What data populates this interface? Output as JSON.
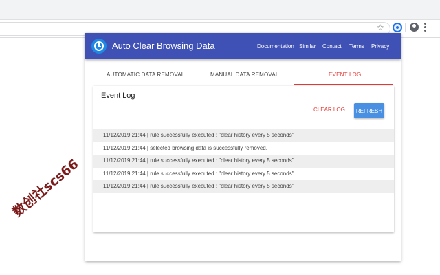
{
  "app": {
    "title": "Auto Clear Browsing Data",
    "nav": [
      "Documentation",
      "Similar",
      "Contact",
      "Terms",
      "Privacy"
    ],
    "brand_color": "#3f51b5",
    "accent_color": "#e53935"
  },
  "tabs": [
    {
      "label": "AUTOMATIC DATA REMOVAL",
      "active": false
    },
    {
      "label": "MANUAL DATA REMOVAL",
      "active": false
    },
    {
      "label": "EVENT LOG",
      "active": true
    }
  ],
  "event_log": {
    "title": "Event Log",
    "clear_label": "CLEAR LOG",
    "refresh_label": "REFRESH",
    "entries": [
      "11/12/2019 21:44 | rule successfully executed : \"clear history every 5 seconds\"",
      "11/12/2019 21:44 | selected browsing data is successfully removed.",
      "11/12/2019 21:44 | rule successfully executed : \"clear history every 5 seconds\"",
      "11/12/2019 21:44 | rule successfully executed : \"clear history every 5 seconds\"",
      "11/12/2019 21:44 | rule successfully executed : \"clear history every 5 seconds\""
    ]
  },
  "browser": {
    "star_glyph": "☆"
  },
  "watermark": "数创社scs66"
}
